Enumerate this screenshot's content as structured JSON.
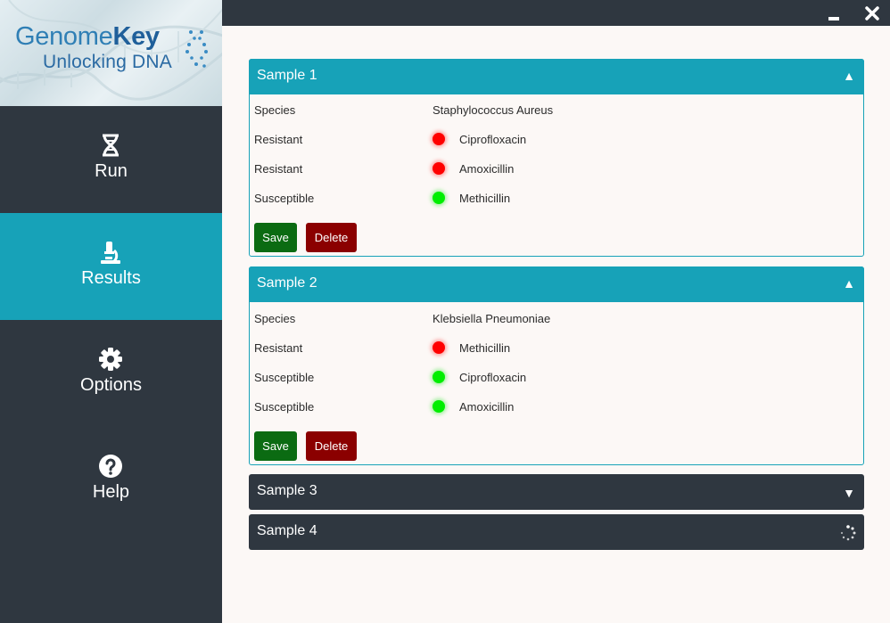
{
  "logo": {
    "word1": "Genome",
    "word2": "Key",
    "subtitle": "Unlocking DNA"
  },
  "nav": [
    {
      "label": "Run",
      "icon": "dna-icon",
      "active": false
    },
    {
      "label": "Results",
      "icon": "microscope-icon",
      "active": true
    },
    {
      "label": "Options",
      "icon": "gear-icon",
      "active": false
    },
    {
      "label": "Help",
      "icon": "question-circle-icon",
      "active": false
    }
  ],
  "window": {
    "minimize": "minimize-icon",
    "close": "close-icon"
  },
  "samples": [
    {
      "title": "Sample 1",
      "state": "expanded",
      "arrow": "▲",
      "species_label": "Species",
      "species": "Staphylococcus Aureus",
      "results": [
        {
          "status": "Resistant",
          "color": "#ff0000",
          "drug": "Ciprofloxacin"
        },
        {
          "status": "Resistant",
          "color": "#ff0000",
          "drug": "Amoxicillin"
        },
        {
          "status": "Susceptible",
          "color": "#00ee00",
          "drug": "Methicillin"
        }
      ],
      "save_label": "Save",
      "delete_label": "Delete"
    },
    {
      "title": "Sample 2",
      "state": "expanded",
      "arrow": "▲",
      "species_label": "Species",
      "species": "Klebsiella Pneumoniae",
      "results": [
        {
          "status": "Resistant",
          "color": "#ff0000",
          "drug": "Methicillin"
        },
        {
          "status": "Susceptible",
          "color": "#00ee00",
          "drug": "Ciprofloxacin"
        },
        {
          "status": "Susceptible",
          "color": "#00ee00",
          "drug": "Amoxicillin"
        }
      ],
      "save_label": "Save",
      "delete_label": "Delete"
    },
    {
      "title": "Sample 3",
      "state": "collapsed",
      "arrow": "▼"
    },
    {
      "title": "Sample 4",
      "state": "loading",
      "indicator": "spinner-icon"
    }
  ],
  "colors": {
    "accent": "#17a2b8",
    "dark": "#2f3740",
    "save": "#0b6b12",
    "delete": "#8b0000",
    "background": "#fcf8f6"
  }
}
